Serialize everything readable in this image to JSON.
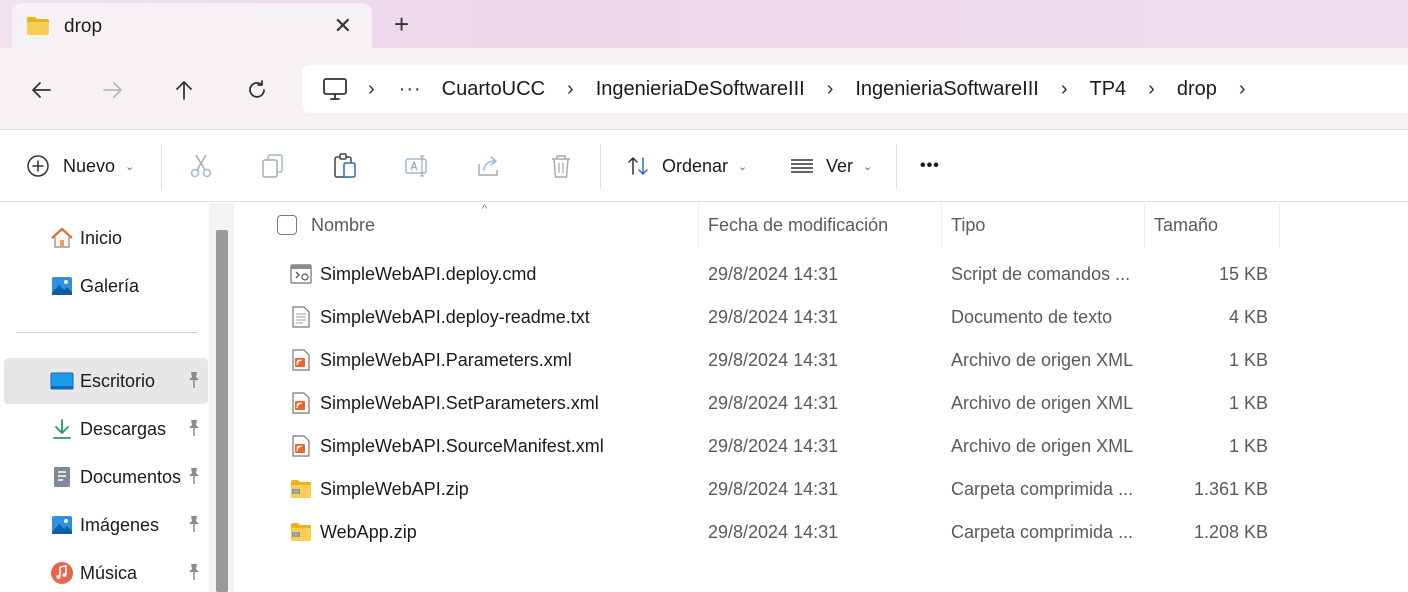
{
  "tab": {
    "title": "drop",
    "close": "✕",
    "new": "+"
  },
  "addressbar": {
    "more": "···",
    "breadcrumbs": [
      "CuartoUCC",
      "IngenieriaDeSoftwareIII",
      "IngenieriaSoftwareIII",
      "TP4",
      "drop"
    ],
    "separator": "›"
  },
  "toolbar": {
    "new_label": "Nuevo",
    "sort_label": "Ordenar",
    "view_label": "Ver",
    "more": "•••",
    "caret": "⌄"
  },
  "sidebar": {
    "items": [
      {
        "label": "Inicio",
        "icon": "home-icon",
        "pinned": false
      },
      {
        "label": "Galería",
        "icon": "gallery-icon",
        "pinned": false
      },
      {
        "label": "Escritorio",
        "icon": "desktop-icon",
        "pinned": true,
        "selected": true
      },
      {
        "label": "Descargas",
        "icon": "download-icon",
        "pinned": true
      },
      {
        "label": "Documentos",
        "icon": "documents-icon",
        "pinned": true
      },
      {
        "label": "Imágenes",
        "icon": "pictures-icon",
        "pinned": true
      },
      {
        "label": "Música",
        "icon": "music-icon",
        "pinned": true
      }
    ]
  },
  "filelist": {
    "columns": {
      "name": "Nombre",
      "date": "Fecha de modificación",
      "type": "Tipo",
      "size": "Tamaño"
    },
    "sort_indicator": "^",
    "rows": [
      {
        "name": "SimpleWebAPI.deploy.cmd",
        "date": "29/8/2024 14:31",
        "type": "Script de comandos ...",
        "size": "15 KB",
        "icon": "cmd-file-icon"
      },
      {
        "name": "SimpleWebAPI.deploy-readme.txt",
        "date": "29/8/2024 14:31",
        "type": "Documento de texto",
        "size": "4 KB",
        "icon": "text-file-icon"
      },
      {
        "name": "SimpleWebAPI.Parameters.xml",
        "date": "29/8/2024 14:31",
        "type": "Archivo de origen XML",
        "size": "1 KB",
        "icon": "xml-file-icon"
      },
      {
        "name": "SimpleWebAPI.SetParameters.xml",
        "date": "29/8/2024 14:31",
        "type": "Archivo de origen XML",
        "size": "1 KB",
        "icon": "xml-file-icon"
      },
      {
        "name": "SimpleWebAPI.SourceManifest.xml",
        "date": "29/8/2024 14:31",
        "type": "Archivo de origen XML",
        "size": "1 KB",
        "icon": "xml-file-icon"
      },
      {
        "name": "SimpleWebAPI.zip",
        "date": "29/8/2024 14:31",
        "type": "Carpeta comprimida ...",
        "size": "1.361 KB",
        "icon": "zip-folder-icon"
      },
      {
        "name": "WebApp.zip",
        "date": "29/8/2024 14:31",
        "type": "Carpeta comprimida ...",
        "size": "1.208 KB",
        "icon": "zip-folder-icon"
      }
    ]
  },
  "colors": {
    "tabstrip": "#ecd5e8",
    "accent": "#0067c0",
    "folder": "#f6c445"
  }
}
